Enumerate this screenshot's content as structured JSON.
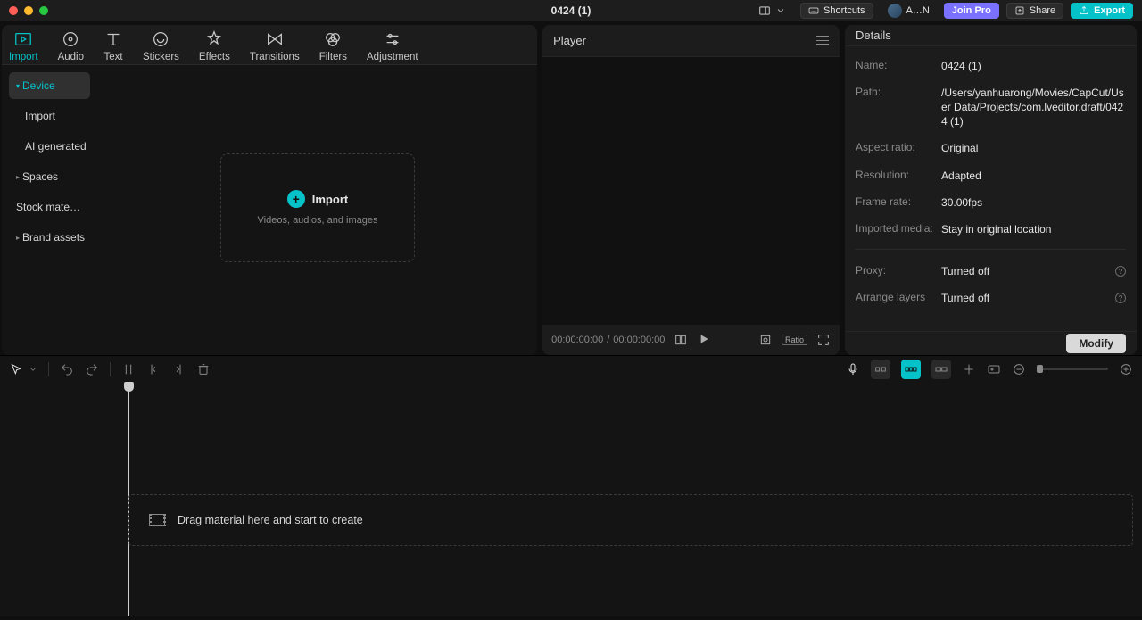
{
  "titlebar": {
    "app_title": "0424 (1)",
    "shortcuts": "Shortcuts",
    "user": "A…N",
    "join_pro": "Join Pro",
    "share": "Share",
    "export": "Export"
  },
  "tabs": [
    {
      "label": "Import",
      "active": true
    },
    {
      "label": "Audio"
    },
    {
      "label": "Text"
    },
    {
      "label": "Stickers"
    },
    {
      "label": "Effects"
    },
    {
      "label": "Transitions"
    },
    {
      "label": "Filters"
    },
    {
      "label": "Adjustment"
    }
  ],
  "sidebar": [
    {
      "label": "Device",
      "caret": "▾",
      "active": true
    },
    {
      "label": "Import",
      "sub": true
    },
    {
      "label": "AI generated",
      "sub": true
    },
    {
      "label": "Spaces",
      "caret": "▸"
    },
    {
      "label": "Stock mate…"
    },
    {
      "label": "Brand assets",
      "caret": "▸"
    }
  ],
  "dropzone": {
    "label": "Import",
    "sub": "Videos, audios, and images"
  },
  "player": {
    "title": "Player",
    "time_current": "00:00:00:00",
    "time_sep": " / ",
    "time_total": "00:00:00:00",
    "ratio": "Ratio"
  },
  "details": {
    "title": "Details",
    "rows": {
      "name_label": "Name:",
      "name_val": "0424 (1)",
      "path_label": "Path:",
      "path_val": "/Users/yanhuarong/Movies/CapCut/User Data/Projects/com.lveditor.draft/0424 (1)",
      "aspect_label": "Aspect ratio:",
      "aspect_val": "Original",
      "res_label": "Resolution:",
      "res_val": "Adapted",
      "fps_label": "Frame rate:",
      "fps_val": "30.00fps",
      "media_label": "Imported media:",
      "media_val": "Stay in original location",
      "proxy_label": "Proxy:",
      "proxy_val": "Turned off",
      "layers_label": "Arrange layers",
      "layers_val": "Turned off"
    },
    "modify": "Modify"
  },
  "timeline": {
    "drop_hint": "Drag material here and start to create"
  }
}
